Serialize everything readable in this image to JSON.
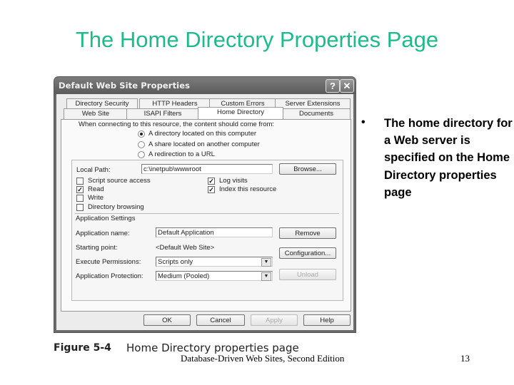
{
  "slide": {
    "title": "The Home Directory Properties Page",
    "title_color": "#1fba8c",
    "bullet_symbol": "•",
    "bullet_text": "The home directory for a Web server is specified on the Home Directory properties page",
    "figure_label": "Figure 5-4",
    "figure_caption": "Home Directory properties page",
    "footer": "Database-Driven Web Sites, Second Edition",
    "page_number": "13"
  },
  "dialog": {
    "title": "Default Web Site Properties",
    "help_icon": "?",
    "close_icon": "✕",
    "tabs_row1": [
      "Directory Security",
      "HTTP Headers",
      "Custom Errors",
      "Server Extensions"
    ],
    "tabs_row2": [
      "Web Site",
      "ISAPI Filters",
      "Home Directory",
      "Documents"
    ],
    "active_tab": "Home Directory",
    "source_prompt": "When connecting to this resource, the content should come from:",
    "source_options": [
      {
        "label": "A directory located on this computer",
        "selected": true
      },
      {
        "label": "A share located on another computer",
        "selected": false
      },
      {
        "label": "A redirection to a URL",
        "selected": false
      }
    ],
    "local_path_label": "Local Path:",
    "local_path_value": "c:\\inetpub\\wwwroot",
    "browse_label": "Browse...",
    "checkboxes_left": [
      {
        "label": "Script source access",
        "checked": false
      },
      {
        "label": "Read",
        "checked": true
      },
      {
        "label": "Write",
        "checked": false
      },
      {
        "label": "Directory browsing",
        "checked": false
      }
    ],
    "checkboxes_right": [
      {
        "label": "Log visits",
        "checked": true
      },
      {
        "label": "Index this resource",
        "checked": true
      }
    ],
    "check_glyph": "✓",
    "app_settings_heading": "Application Settings",
    "app_name_label": "Application name:",
    "app_name_value": "Default Application",
    "remove_label": "Remove",
    "starting_point_label": "Starting point:",
    "starting_point_value": "<Default Web Site>",
    "configuration_label": "Configuration...",
    "exec_perm_label": "Execute Permissions:",
    "exec_perm_value": "Scripts only",
    "app_protection_label": "Application Protection:",
    "app_protection_value": "Medium (Pooled)",
    "unload_label": "Unload",
    "dropdown_arrow": "▼",
    "ok_label": "OK",
    "cancel_label": "Cancel",
    "apply_label": "Apply",
    "help_label": "Help"
  }
}
